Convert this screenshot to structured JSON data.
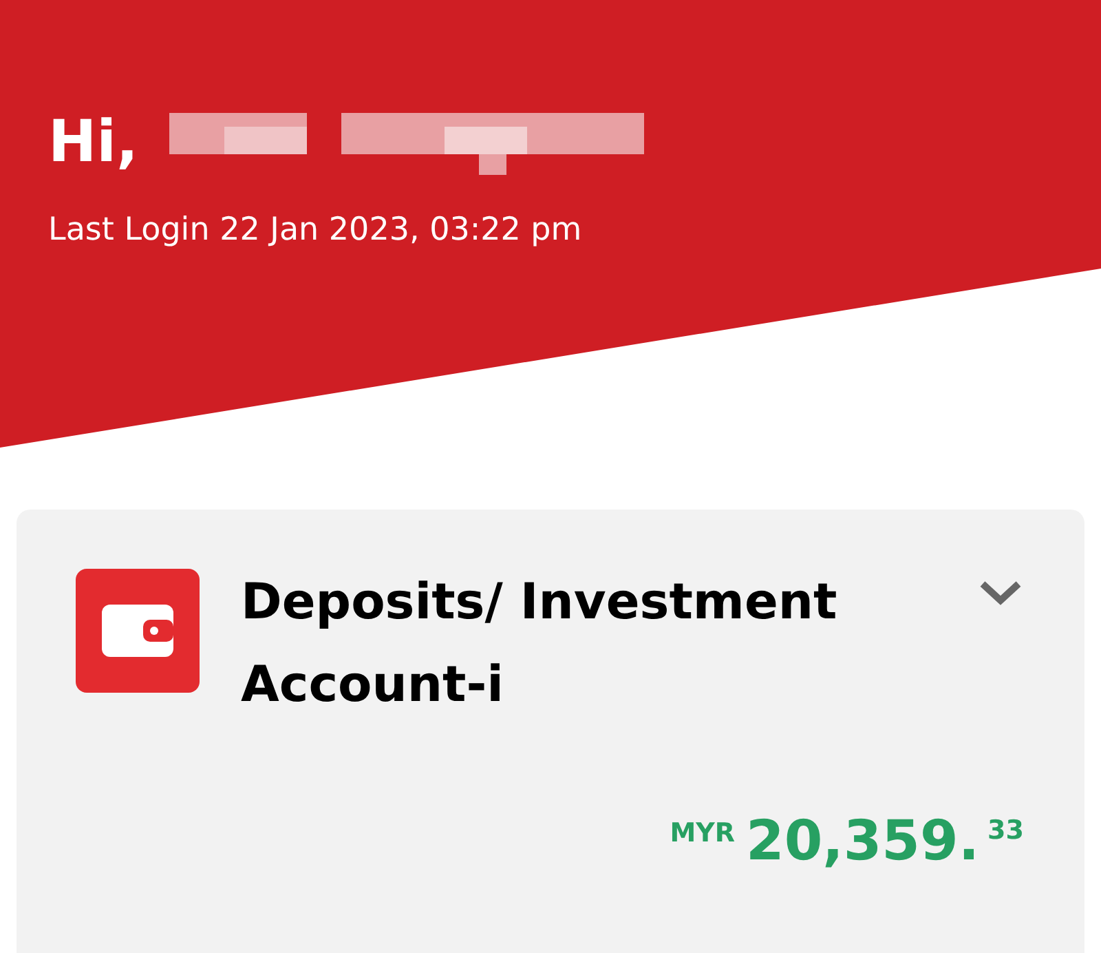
{
  "header": {
    "greeting": "Hi,",
    "last_login": "Last Login 22 Jan 2023, 03:22 pm"
  },
  "account_card": {
    "title": "Deposits/ Investment Account-i",
    "expanded": false,
    "currency": "MYR",
    "amount_whole": "20,359.",
    "amount_cents": "33"
  }
}
